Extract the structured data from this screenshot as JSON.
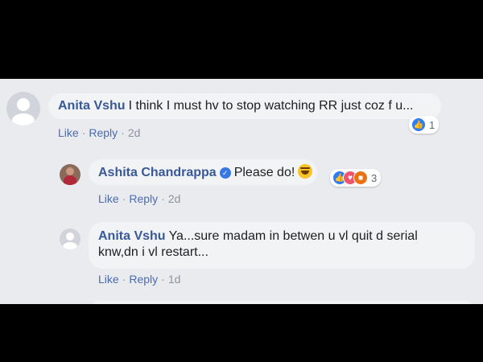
{
  "comments": [
    {
      "author": "Anita Vshu",
      "text": "I think I must hv to stop watching RR just coz f u...",
      "actions": {
        "like": "Like",
        "reply": "Reply",
        "time": "2d"
      },
      "reactions": {
        "count": "1",
        "types": [
          "like-icon"
        ]
      }
    },
    {
      "author": "Ashita Chandrappa",
      "text": "Please do!",
      "verified": true,
      "actions": {
        "like": "Like",
        "reply": "Reply",
        "time": "2d"
      },
      "reactions": {
        "count": "3",
        "types": [
          "like-icon",
          "love-icon",
          "angry-icon"
        ]
      }
    },
    {
      "author": "Anita Vshu",
      "text_line1": "Ya...sure madam in betwen u vl quit d serial",
      "text_line2": "knw,dn i vl restart...",
      "actions": {
        "like": "Like",
        "reply": "Reply",
        "time": "1d"
      }
    }
  ],
  "separator": "·",
  "colors": {
    "page_bg": "#e9ebee",
    "bubble_bg": "#f2f3f5",
    "author": "#385898",
    "link": "#4b6bb3",
    "like_blue": "#2f7cf6",
    "love_red": "#f0556d",
    "angry_orange": "#e9710f"
  }
}
